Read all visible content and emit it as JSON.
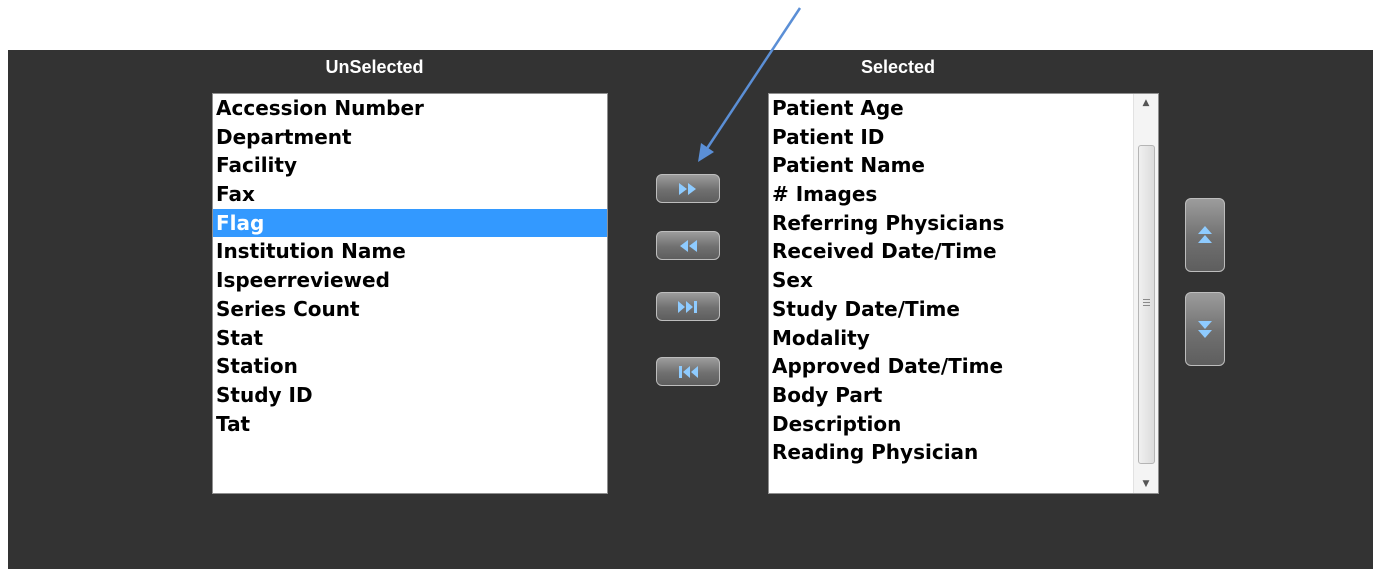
{
  "headings": {
    "unselected": "UnSelected",
    "selected": "Selected"
  },
  "unselected_items": [
    "Accession Number",
    "Department",
    "Facility",
    "Fax",
    "Flag",
    "Institution Name",
    "Ispeerreviewed",
    "Series Count",
    "Stat",
    "Station",
    "Study ID",
    "Tat"
  ],
  "unselected_highlighted_item": "Flag",
  "selected_items": [
    "Patient Age",
    "Patient ID",
    "Patient Name",
    "# Images",
    "Referring Physicians",
    "Received Date/Time",
    "Sex",
    "Study Date/Time",
    "Modality",
    "Approved Date/Time",
    "Body Part",
    "Description",
    "Reading Physician"
  ],
  "buttons": {
    "add": "move-right-icon",
    "remove": "move-left-icon",
    "add_all": "move-all-right-icon",
    "remove_all": "move-all-left-icon",
    "move_up": "move-up-icon",
    "move_down": "move-down-icon"
  },
  "colors": {
    "panel_background": "#333333",
    "selection_highlight": "#3399ff",
    "button_icon": "#8ecbff",
    "annotation_arrow": "#5b8fd6"
  }
}
